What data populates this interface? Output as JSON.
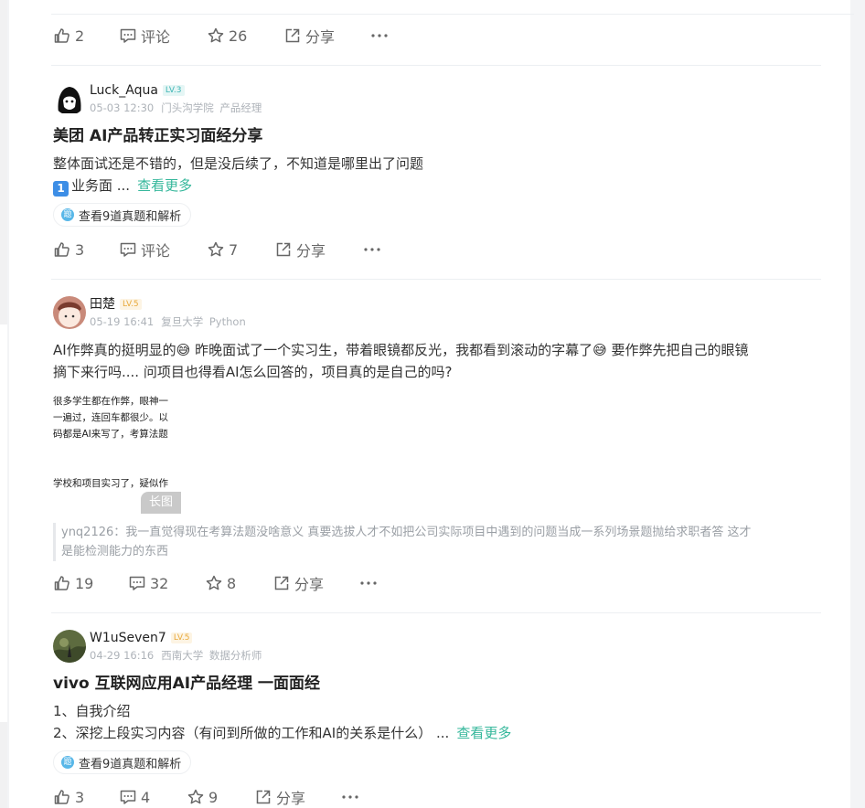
{
  "actions_labels": {
    "comment": "评论",
    "share": "分享"
  },
  "top_actions": {
    "likes": "2",
    "stars": "26"
  },
  "posts": [
    {
      "username": "Luck_Aqua",
      "level": "LV.3",
      "date": "05-03 12:30",
      "school": "门头沟学院",
      "role": "产品经理",
      "title": "美团 AI产品转正实习面经分享",
      "line1": "整体面试还是不错的，但是没后续了，不知道是哪里出了问题",
      "line2_key": "1",
      "line2": "业务面 ...",
      "more": "查看更多",
      "chip": "查看9道真题和解析",
      "chip_icon": "题",
      "likes": "3",
      "stars": "7"
    },
    {
      "username": "田楚",
      "level": "LV.5",
      "date": "05-19 16:41",
      "school": "复旦大学",
      "role": "Python",
      "line1": "AI作弊真的挺明显的😅 昨晚面试了一个实习生，带着眼镜都反光，我都看到滚动的字幕了😅 要作弊先把自己的眼镜",
      "line2": "摘下来行吗.... 问项目也得看AI怎么回答的，项目真的是自己的吗?",
      "image_lines": [
        "很多学生都在作弊，眼神一",
        "一遍过，连回车都很少。以",
        "码都是AI来写了，考算法题",
        "学校和项目实习了，疑似作"
      ],
      "image_tag": "长图",
      "comment_line1": "ynq2126：我一直觉得现在考算法题没啥意义 真要选拔人才不如把公司实际项目中遇到的问题当成一系列场景题抛给求职者答 这才",
      "comment_line2": "是能检测能力的东西",
      "likes": "19",
      "comments": "32",
      "stars": "8"
    },
    {
      "username": "W1uSeven7",
      "level": "LV.5",
      "date": "04-29 16:16",
      "school": "西南大学",
      "role": "数据分析师",
      "title": "vivo 互联网应用AI产品经理 一面面经",
      "line1": "1、自我介绍",
      "line2": "2、深挖上段实习内容（有问到所做的工作和AI的关系是什么） ...",
      "more": "查看更多",
      "chip": "查看9道真题和解析",
      "chip_icon": "题",
      "likes": "3",
      "comments": "4",
      "stars": "9"
    }
  ]
}
